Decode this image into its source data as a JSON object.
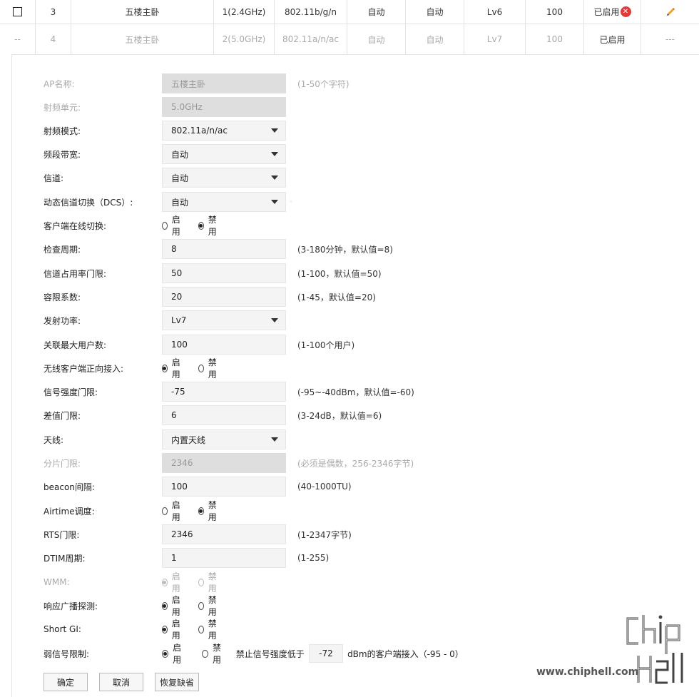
{
  "table": {
    "rows": [
      {
        "index": "3",
        "name": "五楼主卧",
        "radio": "1(2.4GHz)",
        "mode": "802.11b/g/n",
        "bandwidth": "自动",
        "channel": "自动",
        "power": "Lv6",
        "max_users": "100",
        "status": "已启用"
      },
      {
        "checkbox_placeholder": "--",
        "index": "4",
        "name": "五楼主卧",
        "radio": "2(5.0GHz)",
        "mode": "802.11a/n/ac",
        "bandwidth": "自动",
        "channel": "自动",
        "power": "Lv7",
        "max_users": "100",
        "status": "已启用",
        "action": "---"
      }
    ]
  },
  "form": {
    "ap_name": {
      "label": "AP名称:",
      "value": "五楼主卧",
      "hint": "(1-50个字符)"
    },
    "radio_unit": {
      "label": "射频单元:",
      "value": "5.0GHz"
    },
    "radio_mode": {
      "label": "射频模式:",
      "value": "802.11a/n/ac"
    },
    "bandwidth": {
      "label": "频段带宽:",
      "value": "自动"
    },
    "channel": {
      "label": "信道:",
      "value": "自动"
    },
    "dcs": {
      "label": "动态信道切换（DCS）:",
      "value": "自动"
    },
    "client_switch": {
      "label": "客户端在线切换:",
      "opt_on": "启用",
      "opt_off": "禁用",
      "selected": "off"
    },
    "check_period": {
      "label": "检查周期:",
      "value": "8",
      "hint": "(3-180分钟，默认值=8)"
    },
    "channel_util": {
      "label": "信道占用率门限:",
      "value": "50",
      "hint": "(1-100，默认值=50)"
    },
    "tolerance": {
      "label": "容限系数:",
      "value": "20",
      "hint": "(1-45，默认值=20)"
    },
    "tx_power": {
      "label": "发射功率:",
      "value": "Lv7"
    },
    "max_clients": {
      "label": "关联最大用户数:",
      "value": "100",
      "hint": "(1-100个用户)"
    },
    "forward_access": {
      "label": "无线客户端正向接入:",
      "opt_on": "启用",
      "opt_off": "禁用",
      "selected": "on"
    },
    "rssi_threshold": {
      "label": "信号强度门限:",
      "value": "-75",
      "hint": "(-95~-40dBm，默认值=-60)"
    },
    "diff_threshold": {
      "label": "差值门限:",
      "value": "6",
      "hint": "(3-24dB，默认值=6)"
    },
    "antenna": {
      "label": "天线:",
      "value": "内置天线"
    },
    "frag_threshold": {
      "label": "分片门限:",
      "value": "2346",
      "hint": "(必须是偶数，256-2346字节)"
    },
    "beacon": {
      "label": "beacon间隔:",
      "value": "100",
      "hint": "(40-1000TU)"
    },
    "airtime": {
      "label": "Airtime调度:",
      "opt_on": "启用",
      "opt_off": "禁用",
      "selected": "off"
    },
    "rts": {
      "label": "RTS门限:",
      "value": "2346",
      "hint": "(1-2347字节)"
    },
    "dtim": {
      "label": "DTIM周期:",
      "value": "1",
      "hint": "(1-255)"
    },
    "wmm": {
      "label": "WMM:",
      "opt_on": "启用",
      "opt_off": "禁用",
      "selected": "on"
    },
    "probe_response": {
      "label": "响应广播探测:",
      "opt_on": "启用",
      "opt_off": "禁用",
      "selected": "on"
    },
    "short_gi": {
      "label": "Short GI:",
      "opt_on": "启用",
      "opt_off": "禁用",
      "selected": "on"
    },
    "weak_signal": {
      "label": "弱信号限制:",
      "opt_on": "启用",
      "opt_off": "禁用",
      "selected": "on",
      "prefix": "禁止信号强度低于",
      "value": "-72",
      "suffix": "dBm的客户端接入（-95 - 0）"
    }
  },
  "buttons": {
    "ok": "确定",
    "cancel": "取消",
    "restore": "恢复缺省"
  },
  "watermark": {
    "url": "www.chiphell.com"
  },
  "colors": {
    "error_red": "#e03a3a",
    "pencil_orange": "#f0a020"
  }
}
